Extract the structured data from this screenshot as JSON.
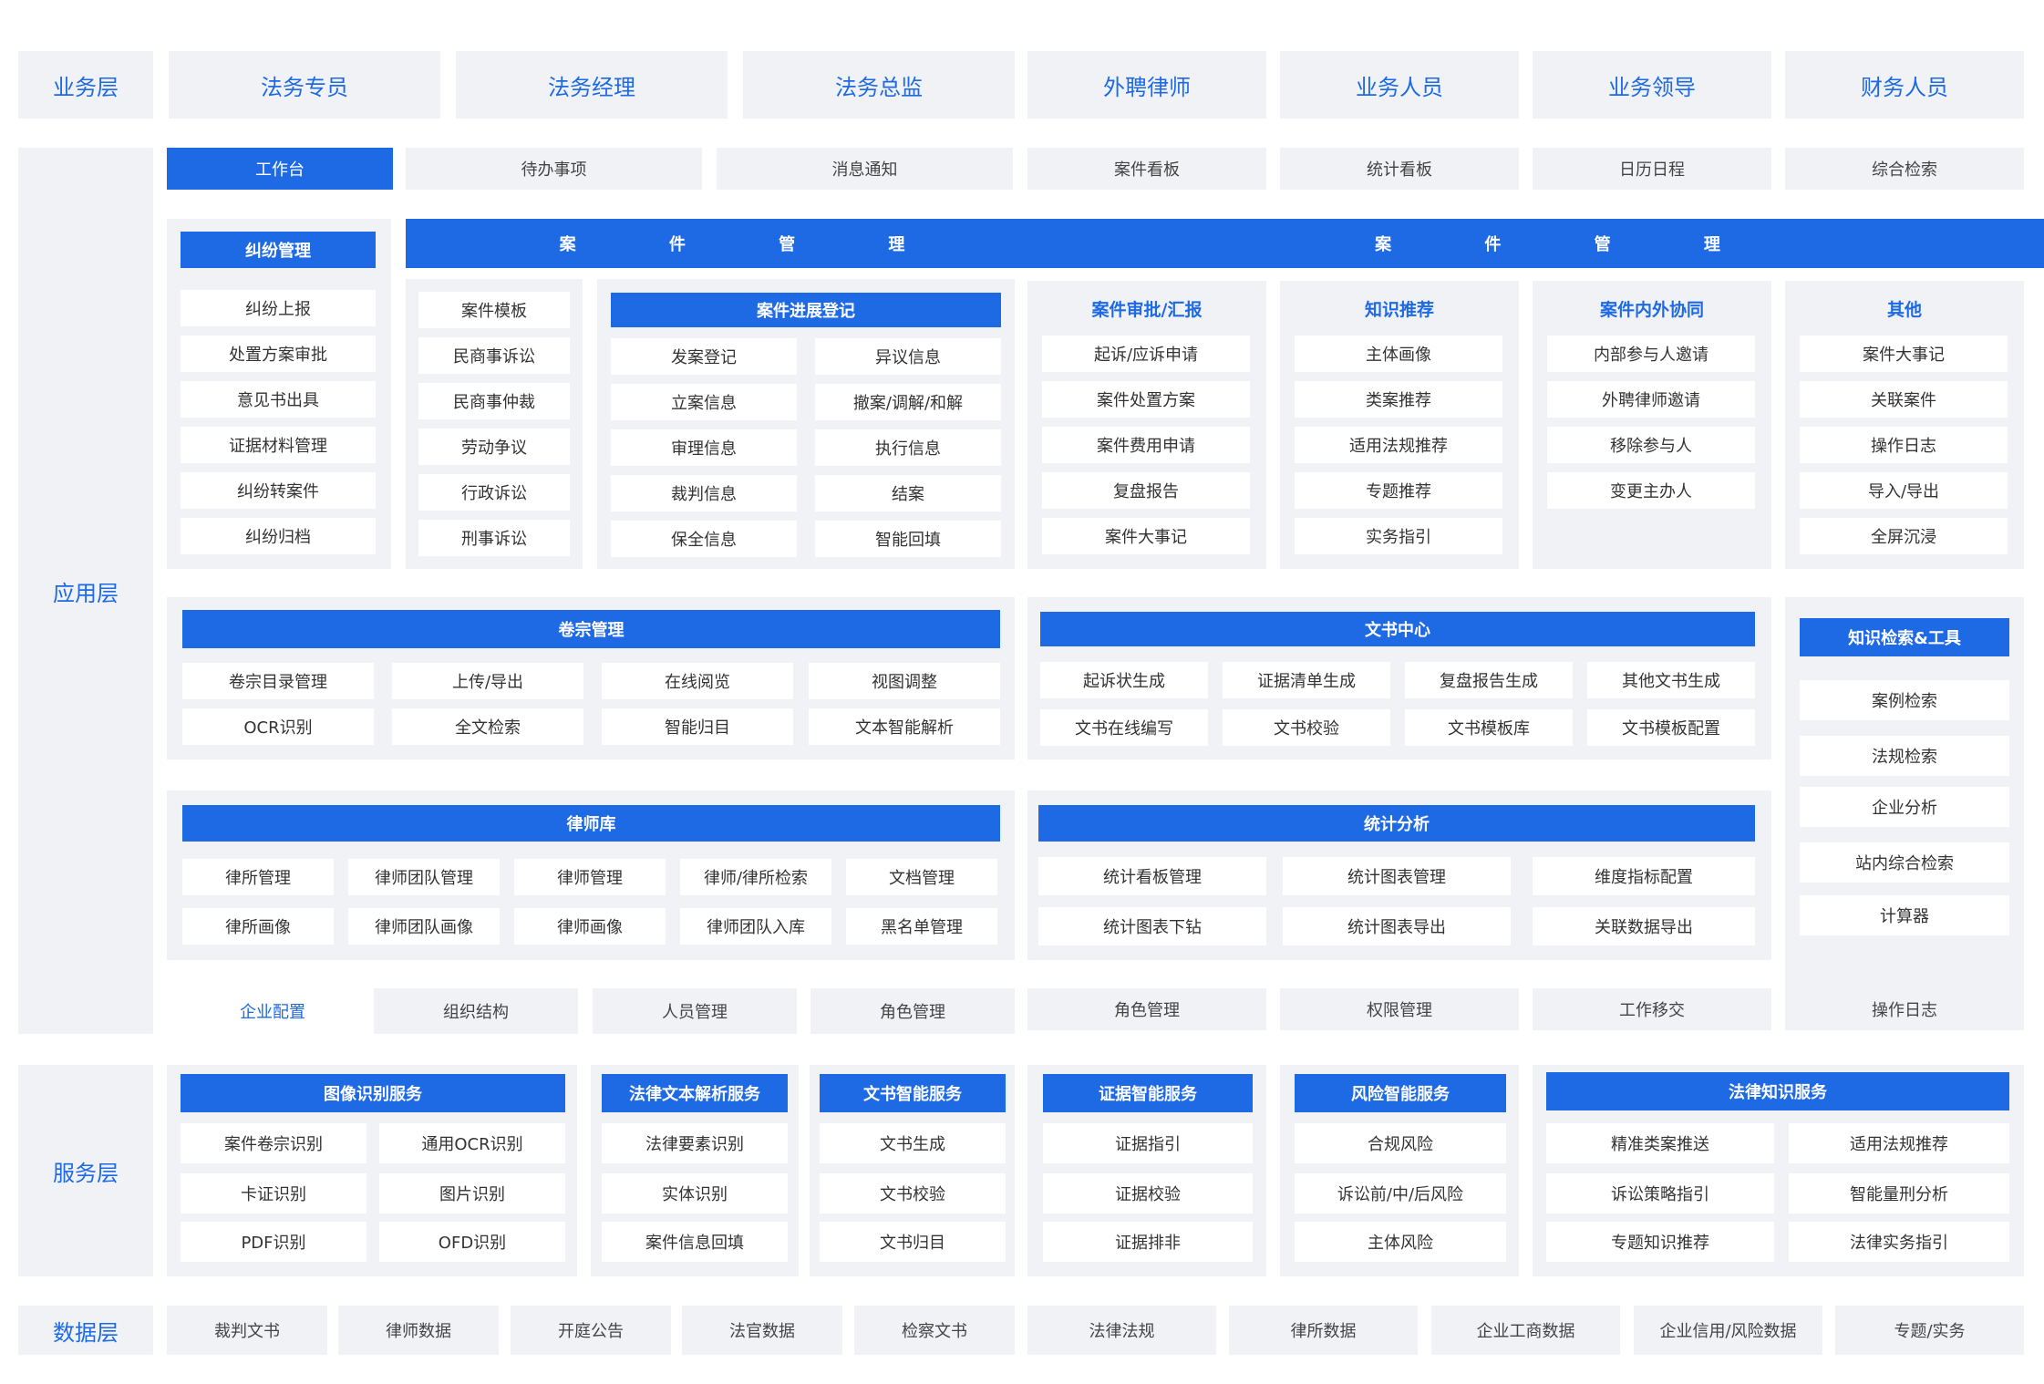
{
  "layers": {
    "business": "业务层",
    "application": "应用层",
    "service": "服务层",
    "data": "数据层"
  },
  "roles": [
    "法务专员",
    "法务经理",
    "法务总监",
    "外聘律师",
    "业务人员",
    "业务领导",
    "财务人员"
  ],
  "nav": [
    "工作台",
    "待办事项",
    "消息通知",
    "案件看板",
    "统计看板",
    "日历日程",
    "综合检索"
  ],
  "dispute": {
    "title": "纠纷管理",
    "items": [
      "纠纷上报",
      "处置方案审批",
      "意见书出具",
      "证据材料管理",
      "纠纷转案件",
      "纠纷归档"
    ]
  },
  "case_left": {
    "title": "案 件 管 理",
    "templates": [
      "案件模板",
      "民商事诉讼",
      "民商事仲裁",
      "劳动争议",
      "行政诉讼",
      "刑事诉讼"
    ],
    "progress_title": "案件进展登记",
    "progress": [
      "发案登记",
      "异议信息",
      "立案信息",
      "撤案/调解/和解",
      "审理信息",
      "执行信息",
      "裁判信息",
      "结案",
      "保全信息",
      "智能回填"
    ]
  },
  "case_right": {
    "title": "案 件 管 理",
    "groups": [
      {
        "title": "案件审批/汇报",
        "items": [
          "起诉/应诉申请",
          "案件处置方案",
          "案件费用申请",
          "复盘报告",
          "案件大事记"
        ]
      },
      {
        "title": "知识推荐",
        "items": [
          "主体画像",
          "类案推荐",
          "适用法规推荐",
          "专题推荐",
          "实务指引"
        ]
      },
      {
        "title": "案件内外协同",
        "items": [
          "内部参与人邀请",
          "外聘律师邀请",
          "移除参与人",
          "变更主办人"
        ]
      },
      {
        "title": "其他",
        "items": [
          "案件大事记",
          "关联案件",
          "操作日志",
          "导入/导出",
          "全屏沉浸"
        ]
      }
    ]
  },
  "archive": {
    "title": "卷宗管理",
    "items": [
      "卷宗目录管理",
      "上传/导出",
      "在线阅览",
      "视图调整",
      "OCR识别",
      "全文检索",
      "智能归目",
      "文本智能解析"
    ]
  },
  "docs": {
    "title": "文书中心",
    "items": [
      "起诉状生成",
      "证据清单生成",
      "复盘报告生成",
      "其他文书生成",
      "文书在线编写",
      "文书校验",
      "文书模板库",
      "文书模板配置"
    ]
  },
  "lawyers": {
    "title": "律师库",
    "items": [
      "律所管理",
      "律师团队管理",
      "律师管理",
      "律师/律所检索",
      "文档管理",
      "律所画像",
      "律师团队画像",
      "律师画像",
      "律师团队入库",
      "黑名单管理"
    ]
  },
  "stats": {
    "title": "统计分析",
    "items": [
      "统计看板管理",
      "统计图表管理",
      "维度指标配置",
      "统计图表下钻",
      "统计图表导出",
      "关联数据导出"
    ]
  },
  "knowledge": {
    "title": "知识检索&工具",
    "items": [
      "案例检索",
      "法规检索",
      "企业分析",
      "站内综合检索",
      "计算器"
    ]
  },
  "config": {
    "title": "企业配置",
    "items": [
      "组织结构",
      "人员管理",
      "角色管理",
      "角色管理",
      "权限管理",
      "工作移交",
      "操作日志"
    ]
  },
  "services": [
    {
      "title": "图像识别服务",
      "items": [
        "案件卷宗识别",
        "通用OCR识别",
        "卡证识别",
        "图片识别",
        "PDF识别",
        "OFD识别"
      ]
    },
    {
      "title": "法律文本解析服务",
      "items": [
        "法律要素识别",
        "实体识别",
        "案件信息回填"
      ]
    },
    {
      "title": "文书智能服务",
      "items": [
        "文书生成",
        "文书校验",
        "文书归目"
      ]
    },
    {
      "title": "证据智能服务",
      "items": [
        "证据指引",
        "证据校验",
        "证据排非"
      ]
    },
    {
      "title": "风险智能服务",
      "items": [
        "合规风险",
        "诉讼前/中/后风险",
        "主体风险"
      ]
    },
    {
      "title": "法律知识服务",
      "items": [
        "精准类案推送",
        "适用法规推荐",
        "诉讼策略指引",
        "智能量刑分析",
        "专题知识推荐",
        "法律实务指引"
      ]
    }
  ],
  "data_sources": [
    "裁判文书",
    "律师数据",
    "开庭公告",
    "法官数据",
    "检察文书",
    "法律法规",
    "律所数据",
    "企业工商数据",
    "企业信用/风险数据",
    "专题/实务"
  ],
  "colors": {
    "accent": "#1e6ae5",
    "panel": "#f1f2f5"
  }
}
